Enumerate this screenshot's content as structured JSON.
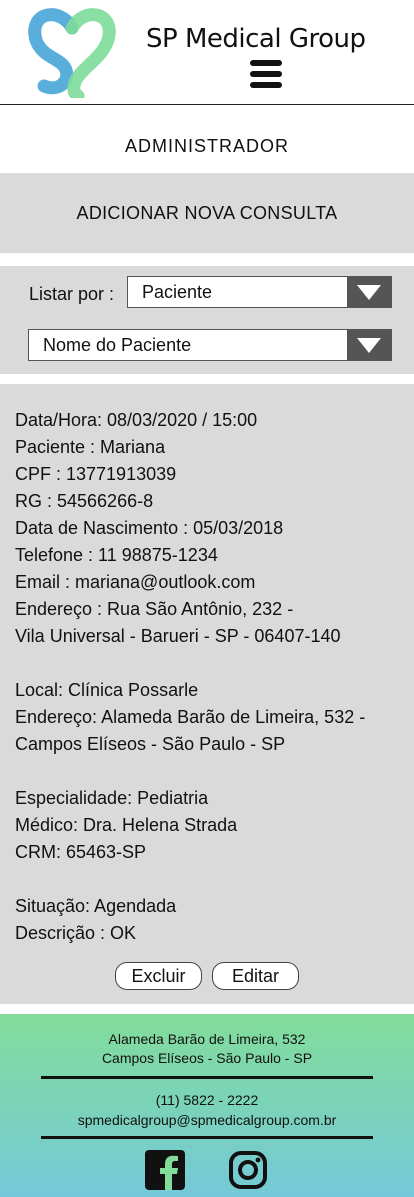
{
  "header": {
    "brand": "SP Medical Group",
    "logo_icon": "sp-heart-logo",
    "menu_icon": "hamburger-menu-icon"
  },
  "role_title": "ADMINISTRADOR",
  "add_consulta_label": "ADICIONAR NOVA CONSULTA",
  "filter": {
    "label": "Listar por :",
    "list_by_value": "Paciente",
    "name_value": "Nome do Paciente"
  },
  "consulta": {
    "datahora": "Data/Hora: 08/03/2020 / 15:00",
    "paciente": "Paciente : Mariana",
    "cpf": "CPF : 13771913039",
    "rg": "RG : 54566266-8",
    "nascimento": "Data de Nascimento : 05/03/2018",
    "telefone": "Telefone : 11 98875-1234",
    "email": "Email : mariana@outlook.com",
    "endereco_1": "Endereço : Rua São Antônio, 232 -",
    "endereco_2": "Vila Universal - Barueri - SP - 06407-140",
    "local": "Local: Clínica Possarle",
    "local_endereco_1": "Endereço: Alameda Barão de Limeira, 532 -",
    "local_endereco_2": "Campos Elíseos - São Paulo - SP",
    "especialidade": "Especialidade: Pediatria",
    "medico": "Médico: Dra. Helena Strada",
    "crm": "CRM: 65463-SP",
    "situacao": "Situação: Agendada",
    "descricao": "Descrição : OK",
    "excluir_label": "Excluir",
    "editar_label": "Editar"
  },
  "footer": {
    "address_1": "Alameda Barão de Limeira, 532",
    "address_2": "Campos Elíseos - São Paulo - SP",
    "phone": "(11) 5822 - 2222",
    "email": "spmedicalgroup@spmedicalgroup.com.br",
    "facebook_icon": "facebook-icon",
    "instagram_icon": "instagram-icon"
  },
  "colors": {
    "panel_gray": "#dadada",
    "footer_green": "#82dd9a",
    "footer_blue": "#74c9d8",
    "logo_blue": "#5aaedb",
    "logo_green": "#7ddc9a"
  }
}
